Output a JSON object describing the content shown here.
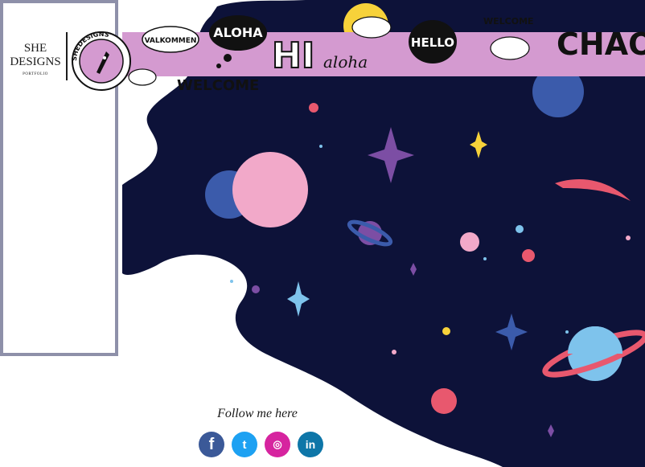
{
  "brand": {
    "name": "SHE DESIGNS",
    "subtitle": "PORTFOLIO",
    "logo_ring_text": "SHEDESIGNS"
  },
  "banner": {
    "greetings": [
      "VALKOMMEN",
      "ALOHA",
      "HI",
      "aloha",
      "HELLO",
      "WELCOME",
      "CHAO",
      "WELCOME"
    ]
  },
  "footer": {
    "follow_label": "Follow me here"
  },
  "socials": [
    {
      "name": "facebook",
      "glyph": "f"
    },
    {
      "name": "twitter",
      "glyph": "t"
    },
    {
      "name": "instagram",
      "glyph": "◎"
    },
    {
      "name": "linkedin",
      "glyph": "in"
    }
  ],
  "colors": {
    "space": "#0d1239",
    "banner": "#d49ad0",
    "sidebar_border": "#8e90a9",
    "pink": "#f2a9c9",
    "blue": "#3b5bab",
    "purple": "#7c4ea4",
    "yellow": "#f7d23a",
    "light_blue": "#7ec3ec",
    "coral": "#e8586e"
  }
}
